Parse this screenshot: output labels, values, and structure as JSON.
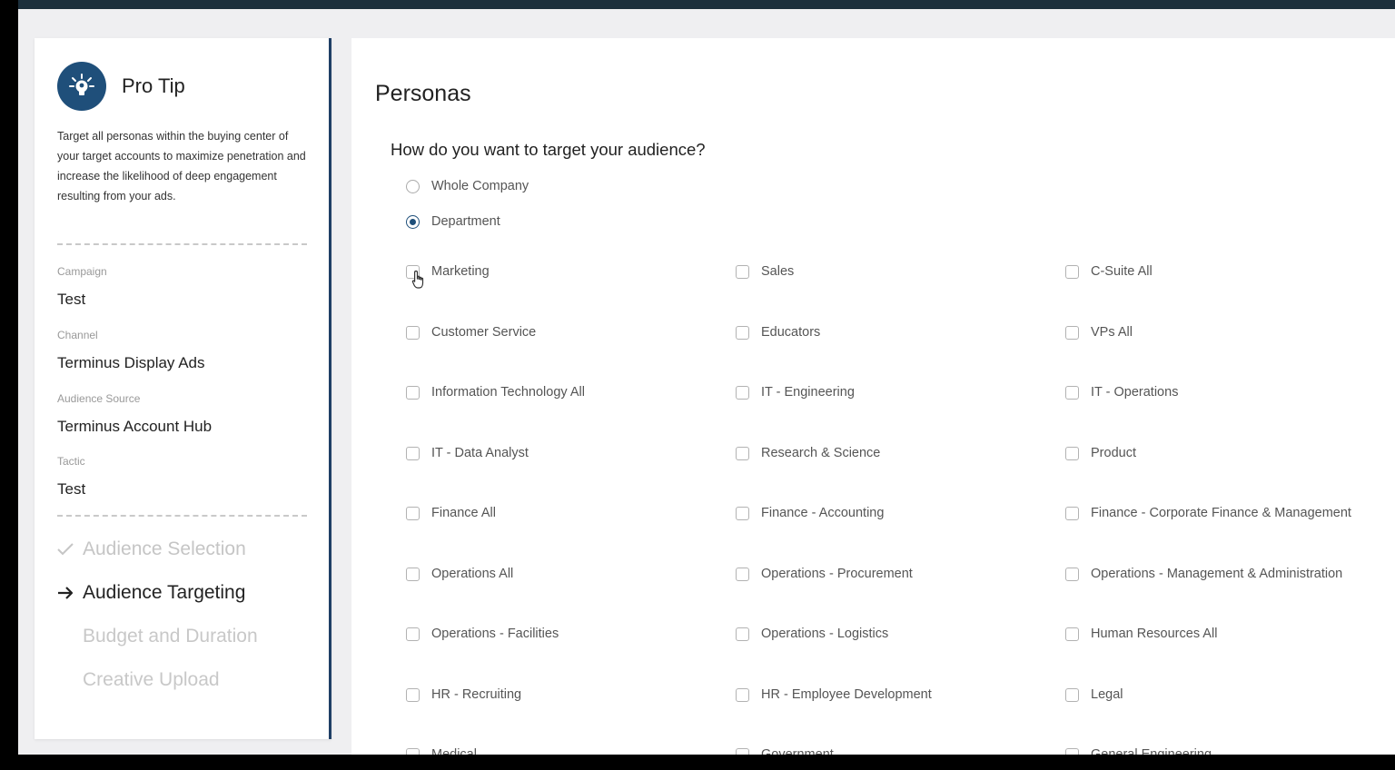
{
  "pro_tip": {
    "title": "Pro Tip",
    "text": "Target all personas within the buying center of your target accounts to maximize penetration and increase the likelihood of deep engagement resulting from your ads."
  },
  "campaign_meta": [
    {
      "label": "Campaign",
      "value": "Test"
    },
    {
      "label": "Channel",
      "value": "Terminus Display Ads"
    },
    {
      "label": "Audience Source",
      "value": "Terminus Account Hub"
    },
    {
      "label": "Tactic",
      "value": "Test"
    }
  ],
  "steps": [
    {
      "label": "Audience Selection",
      "state": "done",
      "icon": "check-icon"
    },
    {
      "label": "Audience Targeting",
      "state": "current",
      "icon": "arrow-right-icon"
    },
    {
      "label": "Budget and Duration",
      "state": "todo"
    },
    {
      "label": "Creative Upload",
      "state": "todo"
    }
  ],
  "main": {
    "title": "Personas",
    "question": "How do you want to target your audience?",
    "target_options": [
      {
        "label": "Whole Company",
        "selected": false
      },
      {
        "label": "Department",
        "selected": true
      }
    ],
    "departments": [
      "Marketing",
      "Sales",
      "C-Suite All",
      "Customer Service",
      "Educators",
      "VPs All",
      "Information Technology All",
      "IT - Engineering",
      "IT - Operations",
      "IT - Data Analyst",
      "Research & Science",
      "Product",
      "Finance All",
      "Finance - Accounting",
      "Finance - Corporate Finance & Management",
      "Operations All",
      "Operations - Procurement",
      "Operations - Management & Administration",
      "Operations - Facilities",
      "Operations - Logistics",
      "Human Resources All",
      "HR - Recruiting",
      "HR - Employee Development",
      "Legal",
      "Medical",
      "Government",
      "General Engineering"
    ]
  },
  "colors": {
    "accent": "#1f4f7a",
    "topbar": "#1c2f3c",
    "sidebar_border": "#1f3f66"
  }
}
